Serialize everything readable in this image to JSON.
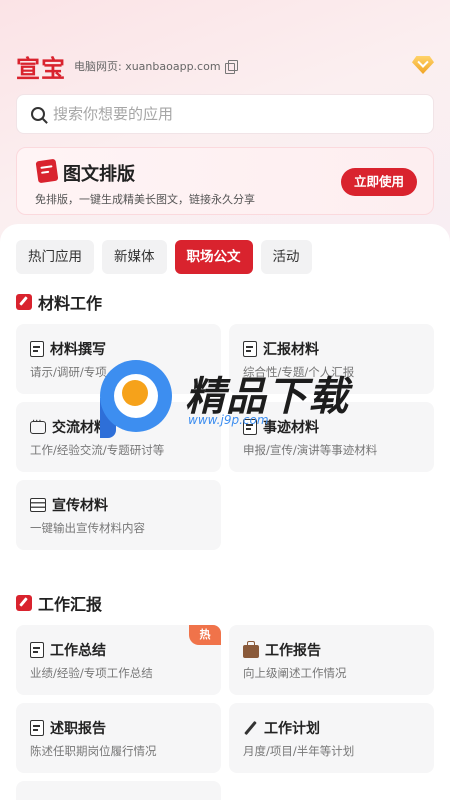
{
  "header": {
    "logo": "宣宝",
    "site_label": "电脑网页: xuanbaoapp.com"
  },
  "search": {
    "placeholder": "搜索你想要的应用"
  },
  "promo": {
    "title": "图文排版",
    "desc": "免排版，一键生成精美长图文，链接永久分享",
    "button": "立即使用"
  },
  "tabs": [
    {
      "label": "热门应用",
      "active": false
    },
    {
      "label": "新媒体",
      "active": false
    },
    {
      "label": "职场公文",
      "active": true
    },
    {
      "label": "活动",
      "active": false
    }
  ],
  "sections": [
    {
      "title": "材料工作",
      "cards": [
        {
          "title": "材料撰写",
          "desc": "请示/调研/专项",
          "icon": "doc-edit-icon"
        },
        {
          "title": "汇报材料",
          "desc": "综合性/专题/个人汇报",
          "icon": "clipboard-icon"
        },
        {
          "title": "交流材料",
          "desc": "工作/经验交流/专题研讨等",
          "icon": "chat-icon"
        },
        {
          "title": "事迹材料",
          "desc": "申报/宣传/演讲等事迹材料",
          "icon": "doc-icon"
        },
        {
          "title": "宣传材料",
          "desc": "一键输出宣传材料内容",
          "icon": "board-icon"
        }
      ]
    },
    {
      "title": "工作汇报",
      "cards": [
        {
          "title": "工作总结",
          "desc": "业绩/经验/专项工作总结",
          "icon": "doc-icon",
          "badge": "热"
        },
        {
          "title": "工作报告",
          "desc": "向上级阐述工作情况",
          "icon": "briefcase-icon"
        },
        {
          "title": "述职报告",
          "desc": "陈述任职期岗位履行情况",
          "icon": "doc-edit-icon"
        },
        {
          "title": "工作计划",
          "desc": "月度/项目/半年等计划",
          "icon": "pen-icon"
        }
      ]
    }
  ],
  "watermark": {
    "text": "精品下载",
    "url": "www.j9p.com"
  },
  "colors": {
    "accent": "#d9232e",
    "hot": "#f0734a"
  }
}
